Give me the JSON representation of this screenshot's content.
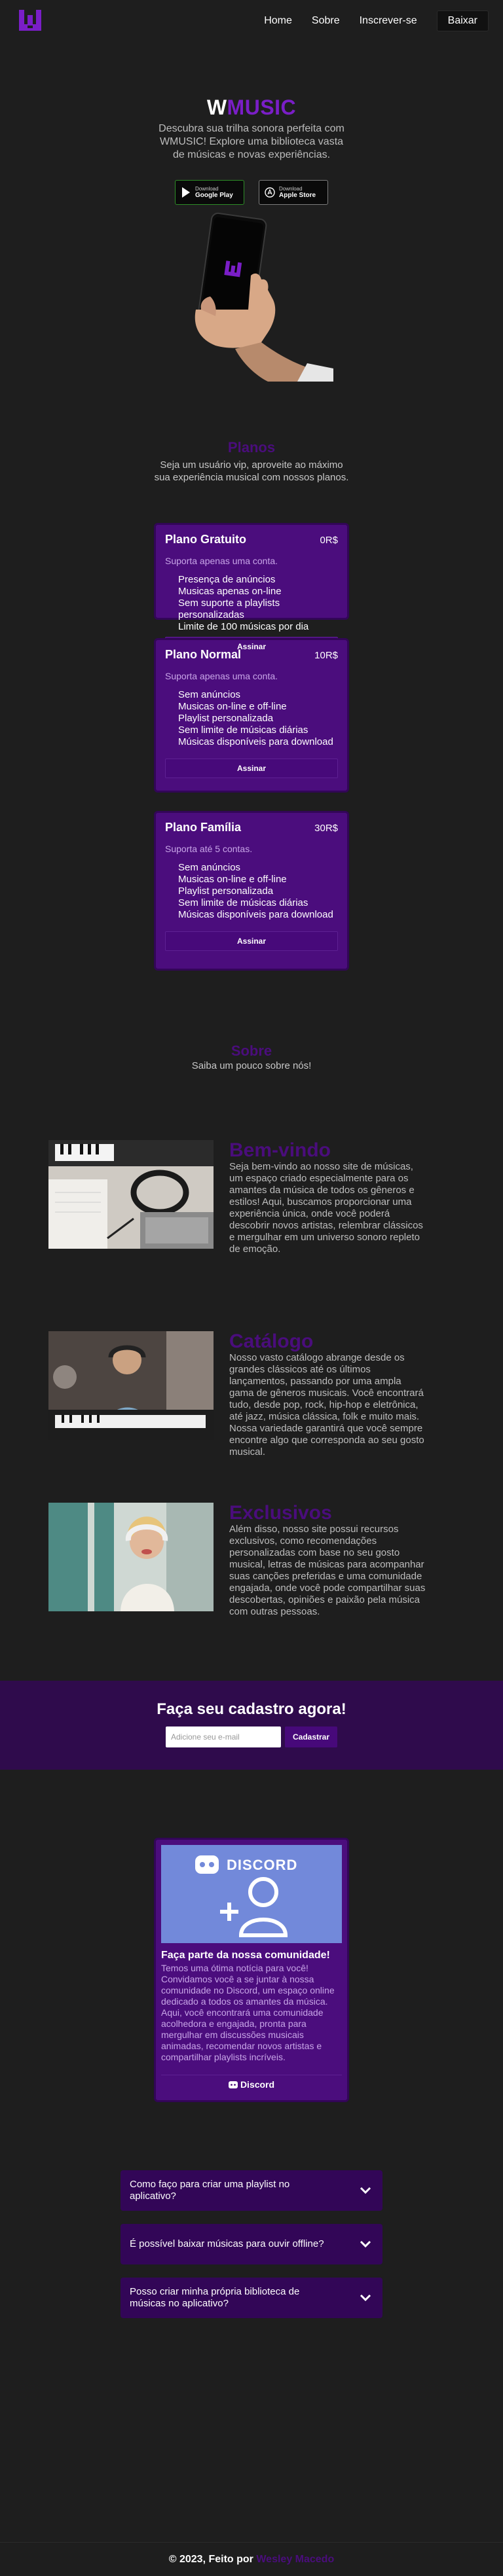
{
  "nav": {
    "links": [
      "Home",
      "Sobre",
      "Inscrever-se"
    ],
    "download_label": "Baixar"
  },
  "hero": {
    "brand_first": "W",
    "brand_rest": "MUSIC",
    "subtitle": "Descubra sua trilha sonora perfeita com WMUSIC! Explore uma biblioteca vasta de músicas e novas experiências.",
    "stores": [
      {
        "small": "Download",
        "big": "Google Play",
        "icon": "google-play-icon"
      },
      {
        "small": "Download",
        "big": "Apple Store",
        "icon": "apple-icon"
      }
    ]
  },
  "plans": {
    "title": "Planos",
    "subtitle": "Seja um usuário vip, aproveite ao máximo sua experiência musical com nossos planos.",
    "items": [
      {
        "name": "Plano Gratuito",
        "price": "0R$",
        "note": "Suporta apenas uma conta.",
        "features": [
          "Presença de anúncios",
          "Musicas apenas on-line",
          "Sem suporte a playlists personalizadas",
          "Limite de 100 músicas por dia"
        ],
        "button": "Assinar"
      },
      {
        "name": "Plano Normal",
        "price": "10R$",
        "note": "Suporta apenas uma conta.",
        "features": [
          "Sem anúncios",
          "Musicas on-line e off-line",
          "Playlist personalizada",
          "Sem limite de músicas diárias",
          "Músicas disponíveis para download"
        ],
        "button": "Assinar"
      },
      {
        "name": "Plano Família",
        "price": "30R$",
        "note": "Suporta até 5 contas.",
        "features": [
          "Sem anúncios",
          "Musicas on-line e off-line",
          "Playlist personalizada",
          "Sem limite de músicas diárias",
          "Músicas disponíveis para download"
        ],
        "button": "Assinar"
      }
    ]
  },
  "about": {
    "title": "Sobre",
    "subtitle": "Saiba um pouco sobre nós!",
    "features": [
      {
        "title": "Bem-vindo",
        "body": "Seja bem-vindo ao nosso site de músicas, um espaço criado especialmente para os amantes da música de todos os gêneros e estilos! Aqui, buscamos proporcionar uma experiência única, onde você poderá descobrir novos artistas, relembrar clássicos e mergulhar em um universo sonoro repleto de emoção."
      },
      {
        "title": "Catálogo",
        "body": "Nosso vasto catálogo abrange desde os grandes clássicos até os últimos lançamentos, passando por uma ampla gama de gêneros musicais. Você encontrará tudo, desde pop, rock, hip-hop e eletrônica, até jazz, música clássica, folk e muito mais. Nossa variedade garantirá que você sempre encontre algo que corresponda ao seu gosto musical."
      },
      {
        "title": "Exclusivos",
        "body": "Além disso, nosso site possui recursos exclusivos, como recomendações personalizadas com base no seu gosto musical, letras de músicas para acompanhar suas canções preferidas e uma comunidade engajada, onde você pode compartilhar suas descobertas, opiniões e paixão pela música com outras pessoas."
      }
    ]
  },
  "signup": {
    "title": "Faça seu cadastro agora!",
    "placeholder": "Adicione seu e-mail",
    "button": "Cadastrar"
  },
  "discord": {
    "banner_text": "DISCORD",
    "title": "Faça parte da nossa comunidade!",
    "body": "Temos uma ótima notícia para você! Convidamos você a se juntar à nossa comunidade no Discord, um espaço online dedicado a todos os amantes da música. Aqui, você encontrará uma comunidade acolhedora e engajada, pronta para mergulhar em discussões musicais animadas, recomendar novos artistas e compartilhar playlists incríveis.",
    "button": "Discord"
  },
  "faq": [
    "Como faço para criar uma playlist no aplicativo?",
    "É possível baixar músicas para ouvir offline?",
    "Posso criar minha própria biblioteca de músicas no aplicativo?"
  ],
  "footer": {
    "text": "© 2023, Feito por ",
    "author": "Wesley Macedo"
  },
  "colors": {
    "background": "#1e1e1e",
    "accent_purple": "#4a0d7c",
    "card_purple": "#4b0d7d",
    "signup_band": "#2f0b4c"
  }
}
